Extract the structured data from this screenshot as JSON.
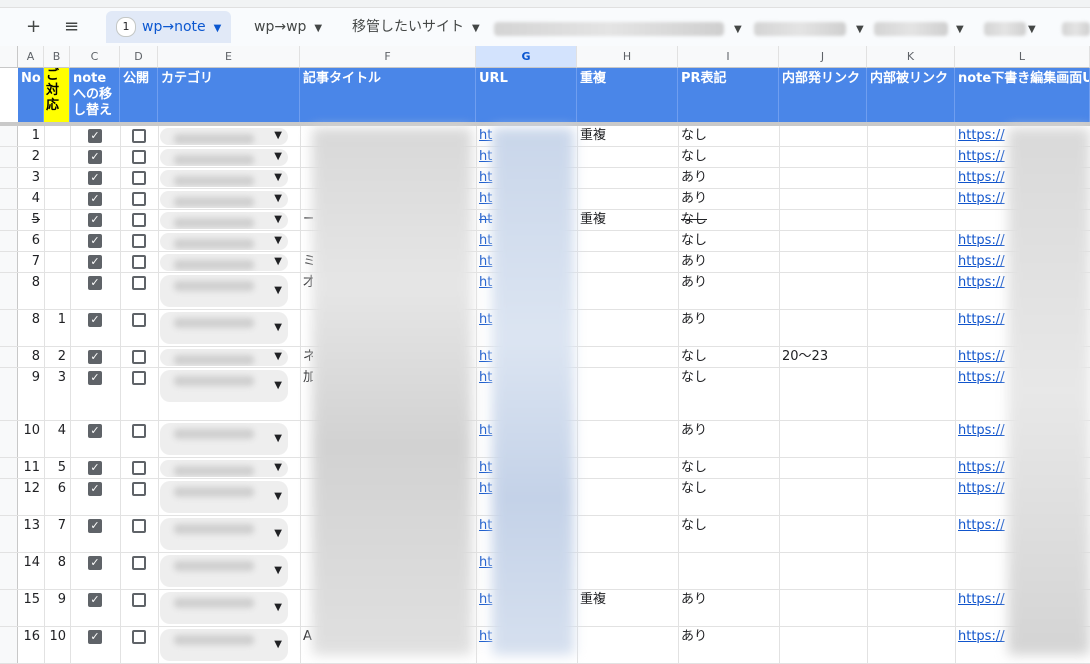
{
  "toolbar": {
    "add_icon": "plus-icon",
    "menu_icon": "menu-icon",
    "tabs": [
      {
        "badge": "1",
        "label": "wp→note",
        "active": true
      },
      {
        "label": "wp→wp",
        "active": false
      },
      {
        "label": "移管したいサイト",
        "active": false
      }
    ]
  },
  "column_letters": [
    "A",
    "B",
    "C",
    "D",
    "E",
    "F",
    "G",
    "H",
    "I",
    "J",
    "K",
    "L"
  ],
  "selected_column": "G",
  "headers": {
    "no": "No",
    "b": "ご対応",
    "note": "noteへの移し替え",
    "public": "公開",
    "category": "カテゴリ",
    "title": "記事タイトル",
    "url": "URL",
    "dup": "重複",
    "pr": "PR表記",
    "internal_out": "内部発リンク",
    "internal_in": "内部被リンク",
    "note_edit": "note下書き編集画面URL"
  },
  "rows": [
    {
      "a": "1",
      "b": "",
      "note": true,
      "pub": false,
      "title_prefix": "",
      "url": "ht",
      "dup": "重複",
      "pr": "なし",
      "j": "",
      "l": "https://",
      "strike": false
    },
    {
      "a": "2",
      "b": "",
      "note": true,
      "pub": false,
      "title_prefix": "",
      "url": "ht",
      "dup": "",
      "pr": "なし",
      "j": "",
      "l": "https://",
      "strike": false
    },
    {
      "a": "3",
      "b": "",
      "note": true,
      "pub": false,
      "title_prefix": "",
      "url": "ht",
      "dup": "",
      "pr": "あり",
      "j": "",
      "l": "https://",
      "strike": false
    },
    {
      "a": "4",
      "b": "",
      "note": true,
      "pub": false,
      "title_prefix": "",
      "url": "ht",
      "dup": "",
      "pr": "あり",
      "j": "",
      "l": "https://",
      "strike": false
    },
    {
      "a": "5",
      "b": "",
      "note": true,
      "pub": false,
      "title_prefix": "ー",
      "url": "ht",
      "dup": "重複",
      "pr": "なし",
      "j": "",
      "l": "",
      "strike": true
    },
    {
      "a": "6",
      "b": "",
      "note": true,
      "pub": false,
      "title_prefix": "",
      "url": "ht",
      "dup": "",
      "pr": "なし",
      "j": "",
      "l": "https://",
      "strike": false
    },
    {
      "a": "7",
      "b": "",
      "note": true,
      "pub": false,
      "title_prefix": "ミ",
      "url": "ht",
      "dup": "",
      "pr": "あり",
      "j": "",
      "l": "https://",
      "strike": false
    },
    {
      "a": "8",
      "b": "",
      "note": true,
      "pub": false,
      "title_prefix": "才",
      "url": "ht",
      "dup": "",
      "pr": "あり",
      "j": "",
      "l": "https://",
      "strike": false
    },
    {
      "a": "8",
      "b": "1",
      "note": true,
      "pub": false,
      "title_prefix": "",
      "url": "ht",
      "dup": "",
      "pr": "あり",
      "j": "",
      "l": "https://",
      "strike": false
    },
    {
      "a": "8",
      "b": "2",
      "note": true,
      "pub": false,
      "title_prefix": "ネ",
      "url": "ht",
      "dup": "",
      "pr": "なし",
      "j": "20〜23",
      "l": "https://",
      "strike": false
    },
    {
      "a": "9",
      "b": "3",
      "note": true,
      "pub": false,
      "title_prefix": "加",
      "url": "ht",
      "dup": "",
      "pr": "なし",
      "j": "",
      "l": "https://",
      "strike": false
    },
    {
      "a": "10",
      "b": "4",
      "note": true,
      "pub": false,
      "title_prefix": "",
      "url": "ht",
      "dup": "",
      "pr": "あり",
      "j": "",
      "l": "https://",
      "strike": false
    },
    {
      "a": "11",
      "b": "5",
      "note": true,
      "pub": false,
      "title_prefix": "",
      "url": "ht",
      "dup": "",
      "pr": "なし",
      "j": "",
      "l": "https://",
      "strike": false
    },
    {
      "a": "12",
      "b": "6",
      "note": true,
      "pub": false,
      "title_prefix": "",
      "url": "ht",
      "dup": "",
      "pr": "なし",
      "j": "",
      "l": "https://",
      "strike": false
    },
    {
      "a": "13",
      "b": "7",
      "note": true,
      "pub": false,
      "title_prefix": "",
      "url": "ht",
      "dup": "",
      "pr": "なし",
      "j": "",
      "l": "https://",
      "strike": false
    },
    {
      "a": "14",
      "b": "8",
      "note": true,
      "pub": false,
      "title_prefix": "",
      "url": "ht",
      "dup": "",
      "pr": "",
      "j": "",
      "l": "",
      "strike": false
    },
    {
      "a": "15",
      "b": "9",
      "note": true,
      "pub": false,
      "title_prefix": "",
      "url": "ht",
      "dup": "重複",
      "pr": "あり",
      "j": "",
      "l": "https://",
      "strike": false
    },
    {
      "a": "16",
      "b": "10",
      "note": true,
      "pub": false,
      "title_prefix": "A",
      "url": "ht",
      "dup": "",
      "pr": "あり",
      "j": "",
      "l": "https://",
      "strike": false
    }
  ],
  "colors": {
    "header_bg": "#4a86e8",
    "header_text": "#ffffff",
    "highlight": "#ffff00",
    "link": "#1155cc",
    "tab_active": "#0b57d0"
  }
}
